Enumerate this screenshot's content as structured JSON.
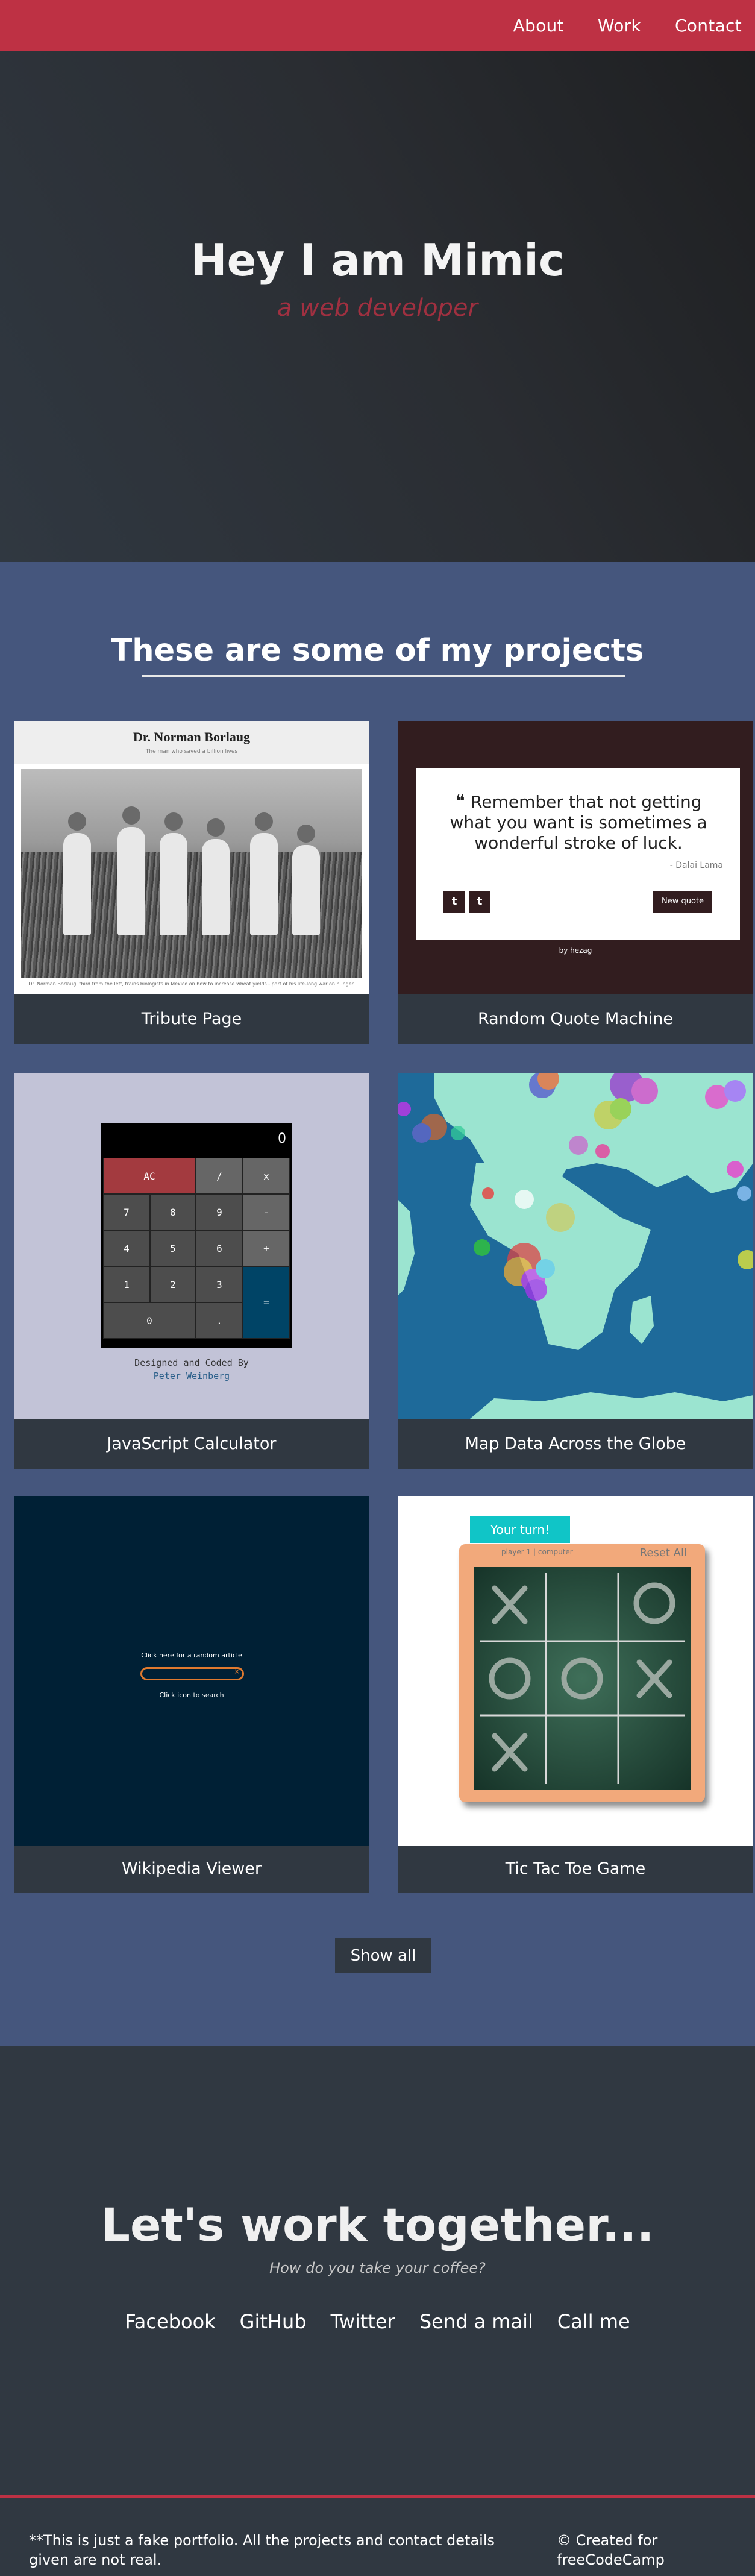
{
  "nav": {
    "items": [
      "About",
      "Work",
      "Contact"
    ]
  },
  "hero": {
    "title": "Hey I am Mimic",
    "subtitle": "a web developer"
  },
  "projects": {
    "heading": "These are some of my projects",
    "tiles": [
      {
        "label": "Tribute Page"
      },
      {
        "label": "Random Quote Machine"
      },
      {
        "label": "JavaScript Calculator"
      },
      {
        "label": "Map Data Across the Globe"
      },
      {
        "label": "Wikipedia Viewer"
      },
      {
        "label": "Tic Tac Toe Game"
      }
    ],
    "show_all": "Show all"
  },
  "thumbs": {
    "tribute": {
      "title": "Dr. Norman Borlaug",
      "subtitle": "The man who saved a billion lives",
      "caption": "Dr. Norman Borlaug, third from the left, trains biologists in Mexico on how to increase wheat yields - part of his life-long war on hunger."
    },
    "quote": {
      "text": "Remember that not getting what you want is sometimes a wonderful stroke of luck.",
      "author": "- Dalai Lama",
      "twitter": "t",
      "tumblr": "t",
      "new_quote": "New quote",
      "by": "by hezag"
    },
    "calc": {
      "clear": "AC",
      "divide": "/",
      "multiply": "x",
      "seven": "7",
      "eight": "8",
      "nine": "9",
      "minus": "-",
      "four": "4",
      "five": "5",
      "six": "6",
      "plus": "+",
      "one": "1",
      "two": "2",
      "three": "3",
      "equals": "=",
      "zero": "0",
      "dot": ".",
      "display": "0",
      "sig1": "Designed and Coded By",
      "sig2": "Peter Weinberg"
    },
    "wiki": {
      "random": "Click here for a random article",
      "search": "Click icon to search"
    },
    "ttt": {
      "turn": "Your turn!",
      "score": "player 1  |  computer",
      "reset": "Reset All"
    }
  },
  "contact": {
    "title": "Let's work together...",
    "subtitle": "How do you take your coffee?",
    "links": [
      "Facebook",
      "GitHub",
      "Twitter",
      "Send a mail",
      "Call me"
    ]
  },
  "footer": {
    "note": "**This is just a fake portfolio. All the projects and contact details given are not real.",
    "credit": "© Created for freeCodeCamp"
  },
  "colors": {
    "accent": "#be3144",
    "dark": "#303841",
    "projects_bg": "#45567d"
  }
}
